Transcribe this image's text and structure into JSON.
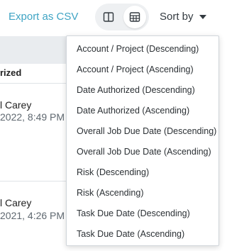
{
  "toolbar": {
    "export_label": "Export as CSV",
    "sort_label": "Sort by",
    "view_toggle": {
      "card_view_icon": "columns-icon",
      "table_view_icon": "table-grid-icon",
      "selected": "table"
    },
    "caret_icon": "caret-down-icon"
  },
  "table": {
    "column_header": "rized",
    "rows": [
      {
        "name": "l Carey",
        "date": "2022, 8:49 PM"
      },
      {
        "name": "l Carey",
        "date": "2021, 4:26 PM"
      }
    ]
  },
  "sort_menu": {
    "options": [
      "Account / Project (Descending)",
      "Account / Project (Ascending)",
      "Date Authorized (Descending)",
      "Date Authorized (Ascending)",
      "Overall Job Due Date (Descending)",
      "Overall Job Due Date (Ascending)",
      "Risk (Descending)",
      "Risk (Ascending)",
      "Task Due Date (Descending)",
      "Task Due Date (Ascending)"
    ]
  },
  "colors": {
    "link": "#3fa4c4",
    "text": "#333a40",
    "toggle_bg": "#eef0f2",
    "header_band": "#e9ecef"
  }
}
